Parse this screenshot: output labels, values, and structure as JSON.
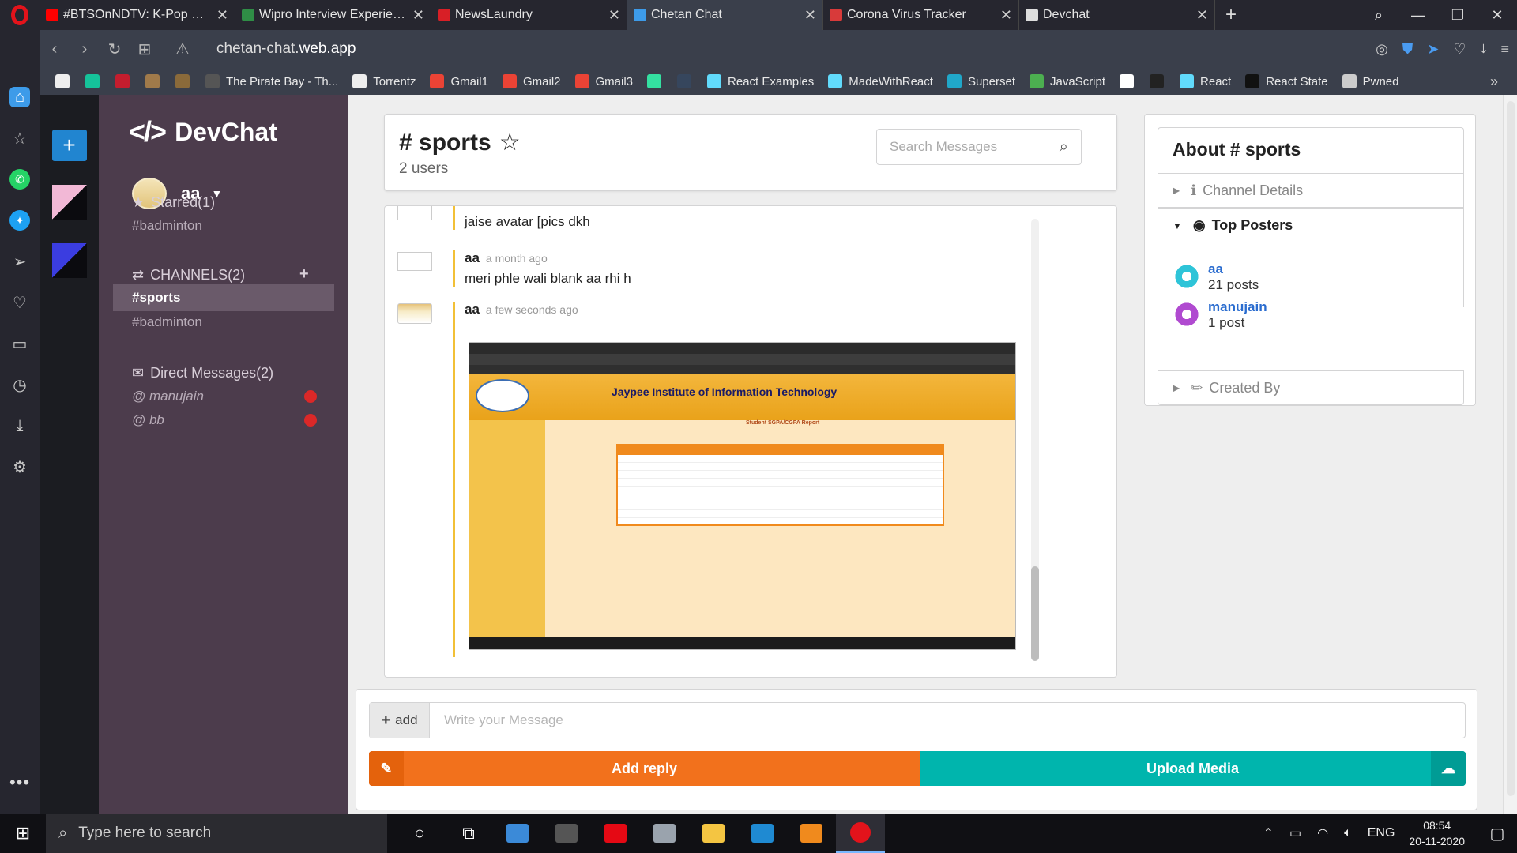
{
  "browser": {
    "tabs": [
      {
        "title": "#BTSOnNDTV: K-Pop Sensa",
        "icon": "youtube-icon",
        "color": "#ff0000",
        "active": false
      },
      {
        "title": "Wipro Interview Experience",
        "icon": "gfg-icon",
        "color": "#2f8d46",
        "active": false
      },
      {
        "title": "NewsLaundry",
        "icon": "newslaundry-icon",
        "color": "#d81f26",
        "active": false
      },
      {
        "title": "Chetan Chat",
        "icon": "devchat-icon",
        "color": "#3d9be9",
        "active": true
      },
      {
        "title": "Corona Virus Tracker",
        "icon": "virus-icon",
        "color": "#d83a3a",
        "active": false
      },
      {
        "title": "Devchat",
        "icon": "page-icon",
        "color": "#dddddd",
        "active": false
      }
    ],
    "url_prefix": "chetan-chat.",
    "url_domain": "web.app",
    "bookmarks": [
      {
        "label": "",
        "icon": "page-icon",
        "color": "#eeeeee"
      },
      {
        "label": "",
        "icon": "grammarly-icon",
        "color": "#15c39a"
      },
      {
        "label": "",
        "icon": "spider-icon",
        "color": "#c41d2e"
      },
      {
        "label": "",
        "icon": "ghost-icon",
        "color": "#a07a4a"
      },
      {
        "label": "",
        "icon": "cartoon-icon",
        "color": "#8a6a3a"
      },
      {
        "label": "The Pirate Bay - Th...",
        "icon": "pirate-icon",
        "color": "#555555"
      },
      {
        "label": "Torrentz",
        "icon": "page-icon",
        "color": "#eeeeee"
      },
      {
        "label": "Gmail1",
        "icon": "gmail-icon",
        "color": "#ea4335"
      },
      {
        "label": "Gmail2",
        "icon": "gmail-icon",
        "color": "#ea4335"
      },
      {
        "label": "Gmail3",
        "icon": "gmail-icon",
        "color": "#ea4335"
      },
      {
        "label": "",
        "icon": "tripadvisor-icon",
        "color": "#34e0a1"
      },
      {
        "label": "",
        "icon": "tumblr-icon",
        "color": "#36465d"
      },
      {
        "label": "React Examples",
        "icon": "react-icon",
        "color": "#61dafb"
      },
      {
        "label": "MadeWithReact",
        "icon": "react-icon",
        "color": "#61dafb"
      },
      {
        "label": "Superset",
        "icon": "superset-icon",
        "color": "#20a7c9"
      },
      {
        "label": "JavaScript",
        "icon": "js-icon",
        "color": "#4caf50"
      },
      {
        "label": "",
        "icon": "hashnode-icon",
        "color": "#ffffff"
      },
      {
        "label": "",
        "icon": "d-icon",
        "color": "#222222"
      },
      {
        "label": "React",
        "icon": "react-icon",
        "color": "#61dafb"
      },
      {
        "label": "React State",
        "icon": "dev-icon",
        "color": "#111111"
      },
      {
        "label": "Pwned",
        "icon": "pwned-icon",
        "color": "#cccccc"
      }
    ]
  },
  "app": {
    "logo": "DevChat",
    "user": {
      "name": "aa"
    },
    "starred": {
      "label": "Starred(1)",
      "items": [
        "#badminton"
      ]
    },
    "channels": {
      "label": "CHANNELS(2)",
      "items": [
        "#sports",
        "#badminton"
      ],
      "active": "#sports"
    },
    "direct": {
      "label": "Direct Messages(2)",
      "items": [
        "@ manujain",
        "@ bb"
      ],
      "status_color": "#db2828"
    }
  },
  "channel": {
    "title": "# sports",
    "users": "2 users",
    "search_placeholder": "Search Messages"
  },
  "messages": [
    {
      "author": "aa",
      "time": "a month ago",
      "text": "jaise avatar [pics dkh"
    },
    {
      "author": "aa",
      "time": "a month ago",
      "text": "meri phle wali blank aa rhi h"
    },
    {
      "author": "aa",
      "time": "a few seconds ago",
      "text": ""
    }
  ],
  "attached_image": {
    "title": "Jaypee Institute of Information Technology",
    "report_title": "Student SGPA/CGPA Report"
  },
  "reply": {
    "add_label": "add",
    "placeholder": "Write your Message",
    "reply_button": "Add reply",
    "upload_button": "Upload Media"
  },
  "meta": {
    "title": "About # sports",
    "channel_details": "Channel Details",
    "top_posters": "Top Posters",
    "created_by": "Created By",
    "posters": [
      {
        "name": "aa",
        "count": "21 posts",
        "color": "#2ec4d8"
      },
      {
        "name": "manujain",
        "count": "1 post",
        "color": "#b04ad0"
      }
    ]
  },
  "taskbar": {
    "search_placeholder": "Type here to search",
    "lang": "ENG",
    "time": "08:54",
    "date": "20-11-2020"
  }
}
